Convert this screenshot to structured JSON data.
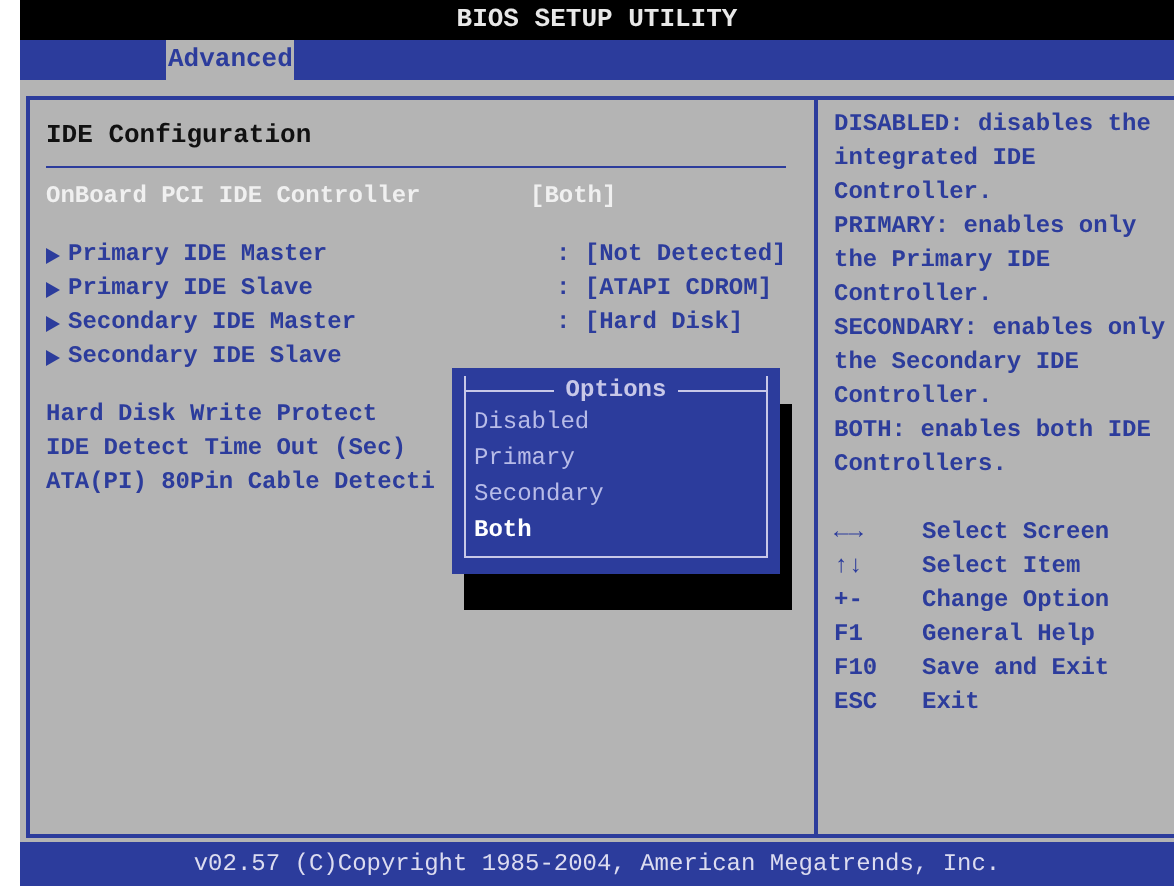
{
  "window": {
    "title": "BIOS SETUP UTILITY"
  },
  "tabs": [
    {
      "label": "Advanced",
      "selected": true
    }
  ],
  "section_title": "IDE Configuration",
  "items": [
    {
      "kind": "setting",
      "label": "OnBoard PCI IDE Controller",
      "value": "[Both]",
      "selected": true
    },
    {
      "kind": "spacer"
    },
    {
      "kind": "submenu",
      "label": "Primary IDE Master",
      "value": ": [Not Detected]",
      "selected": false
    },
    {
      "kind": "submenu",
      "label": "Primary IDE Slave",
      "value": ": [ATAPI CDROM]",
      "selected": false
    },
    {
      "kind": "submenu",
      "label": "Secondary IDE Master",
      "value": ": [Hard Disk]",
      "selected": false
    },
    {
      "kind": "submenu",
      "label": "Secondary IDE Slave",
      "selected": false
    },
    {
      "kind": "spacer"
    },
    {
      "kind": "setting",
      "label": "Hard Disk Write Protect",
      "selected": false
    },
    {
      "kind": "setting",
      "label": "IDE Detect Time Out (Sec)",
      "selected": false
    },
    {
      "kind": "setting",
      "label": "ATA(PI) 80Pin Cable Detecti",
      "selected": false
    }
  ],
  "popup": {
    "title": "Options",
    "options": [
      {
        "label": "Disabled",
        "selected": false
      },
      {
        "label": "Primary",
        "selected": false
      },
      {
        "label": "Secondary",
        "selected": false
      },
      {
        "label": "Both",
        "selected": true
      }
    ]
  },
  "help": [
    "DISABLED: disables the integrated IDE Controller.",
    "PRIMARY: enables only the Primary IDE Controller.",
    "SECONDARY: enables only the Secondary IDE Controller.",
    "BOTH: enables both IDE Controllers."
  ],
  "keys": [
    {
      "key": "←→",
      "action": "Select Screen"
    },
    {
      "key": "↑↓",
      "action": "Select Item"
    },
    {
      "key": "+-",
      "action": "Change Option"
    },
    {
      "key": "F1",
      "action": "General Help"
    },
    {
      "key": "F10",
      "action": "Save and Exit"
    },
    {
      "key": "ESC",
      "action": "Exit"
    }
  ],
  "status_bar": "v02.57 (C)Copyright 1985-2004, American Megatrends, Inc."
}
